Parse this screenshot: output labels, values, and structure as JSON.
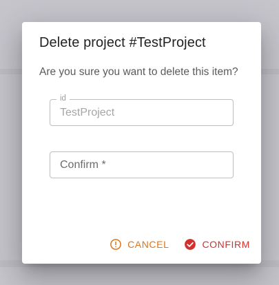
{
  "dialog": {
    "title": "Delete project #TestProject",
    "message": "Are you sure you want to delete this item?"
  },
  "id_field": {
    "label": "id",
    "value": "TestProject"
  },
  "confirm_field": {
    "placeholder": "Confirm *",
    "value": ""
  },
  "actions": {
    "cancel_label": "CANCEL",
    "confirm_label": "CONFIRM",
    "cancel_icon": "alert-circle-icon",
    "confirm_icon": "check-circle-icon"
  },
  "colors": {
    "cancel": "#e07417",
    "confirm": "#d32f2f",
    "backdrop": "#c6c5cc"
  }
}
